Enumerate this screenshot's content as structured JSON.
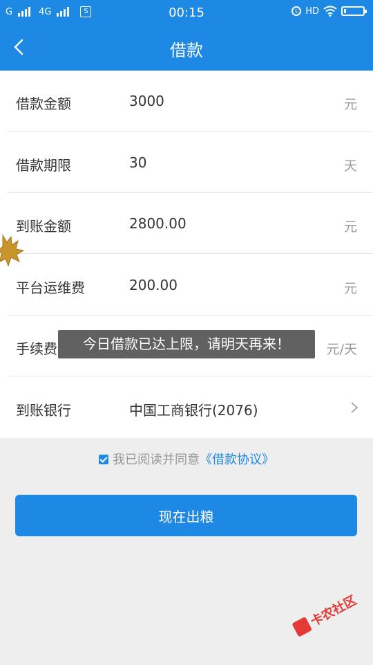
{
  "status_bar": {
    "carrier1": "G",
    "carrier2": "4G",
    "app_badge": "S",
    "time": "00:15",
    "hd": "HD"
  },
  "header": {
    "title": "借款"
  },
  "form": {
    "rows": [
      {
        "label": "借款金额",
        "value": "3000",
        "unit": "元"
      },
      {
        "label": "借款期限",
        "value": "30",
        "unit": "天"
      },
      {
        "label": "到账金额",
        "value": "2800.00",
        "unit": "元"
      },
      {
        "label": "平台运维费",
        "value": "200.00",
        "unit": "元"
      },
      {
        "label": "手续费",
        "value": "",
        "unit": "元/天"
      },
      {
        "label": "到账银行",
        "value": "中国工商银行(2076)"
      }
    ]
  },
  "toast": {
    "message": "今日借款已达上限，请明天再来！"
  },
  "agreement": {
    "checked": true,
    "text": "我已阅读并同意",
    "link": "《借款协议》"
  },
  "submit": {
    "label": "现在出粮"
  },
  "watermark": {
    "text": "卡农社区"
  },
  "colors": {
    "primary": "#1e88e5",
    "background": "#eeeeee"
  }
}
